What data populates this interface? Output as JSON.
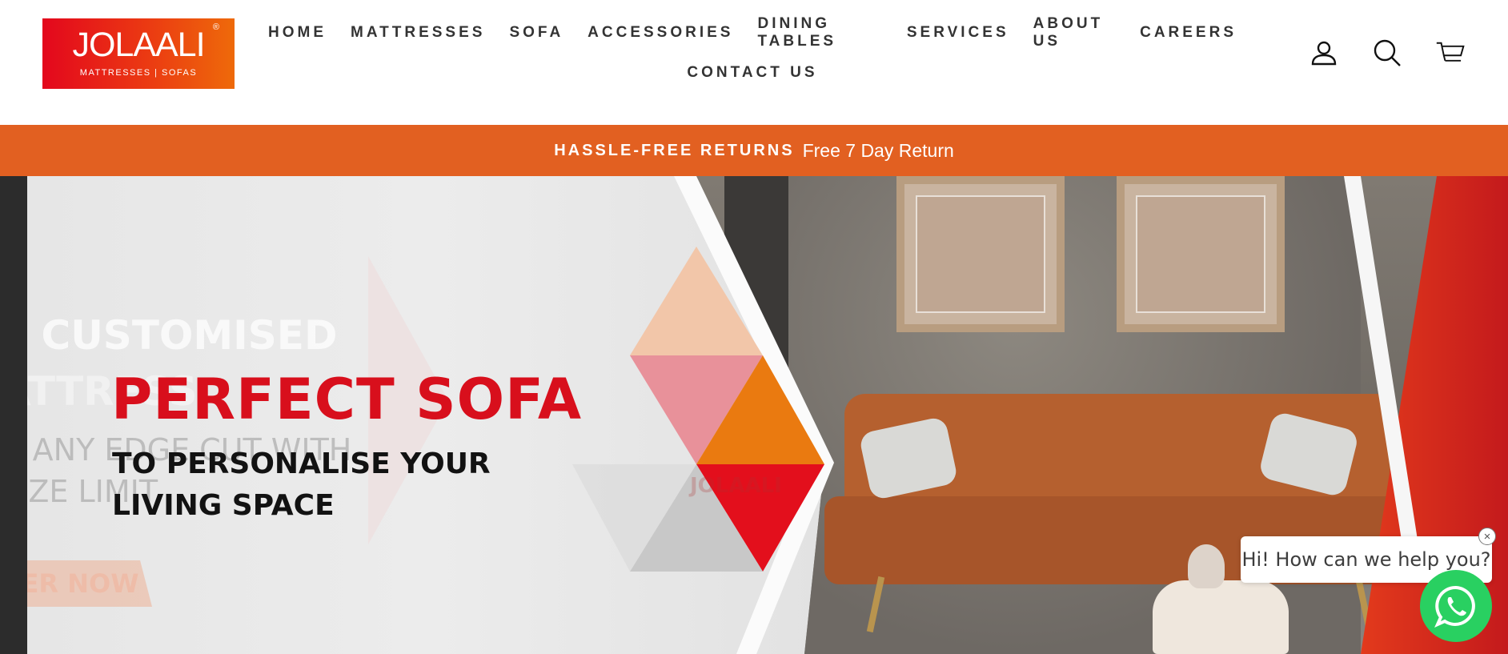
{
  "brand": {
    "name": "JOLAALI",
    "registered_mark": "®",
    "tagline": "MATTRESSES | SOFAS",
    "colors": {
      "primary_red": "#e3071d",
      "primary_orange": "#ee6a0a",
      "announce_bg": "#e26021"
    }
  },
  "nav": {
    "row1": [
      "HOME",
      "MATTRESSES",
      "SOFA",
      "ACCESSORIES",
      "DINING TABLES",
      "SERVICES",
      "ABOUT US",
      "CAREERS"
    ],
    "row2": [
      "CONTACT US"
    ]
  },
  "header_icons": [
    "account-icon",
    "search-icon",
    "cart-icon"
  ],
  "announcement": {
    "strong": "HASSLE-FREE RETURNS",
    "text": "Free 7 Day Return"
  },
  "hero": {
    "title": "PERFECT SOFA",
    "subtitle_line1": "TO PERSONALISE YOUR",
    "subtitle_line2": "LIVING SPACE",
    "ghost_line1": "T CUSTOMISED",
    "ghost_line2": "ATTRESS",
    "ghost_line3": "H ANY EDGE CUT WITH",
    "ghost_line4": "SIZE LIMIT",
    "ghost_button": "DER NOW",
    "watermark": "JOLAALI"
  },
  "chat": {
    "greeting": "Hi! How can we help you?",
    "close_symbol": "×",
    "icon": "whatsapp-icon",
    "color": "#29d061"
  }
}
